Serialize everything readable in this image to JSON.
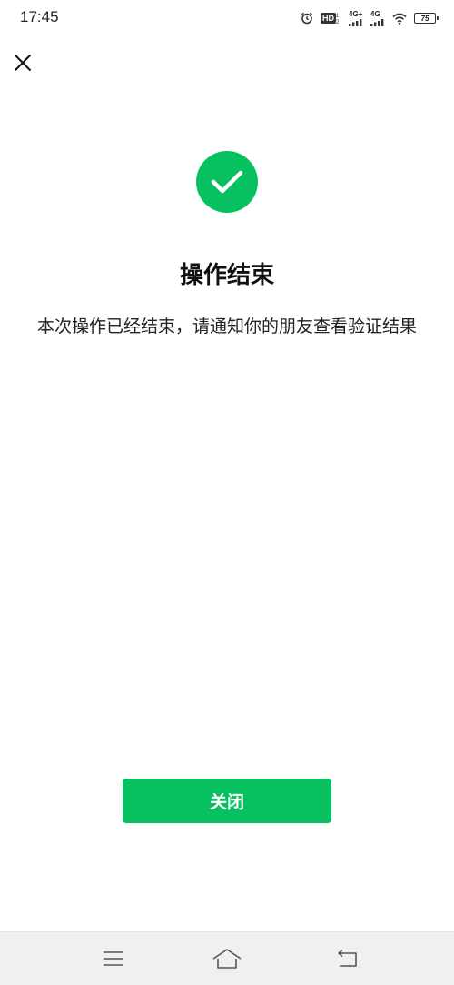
{
  "status_bar": {
    "time": "17:45",
    "hd_label": "HD",
    "sim1_network": "4G+",
    "sim2_network": "4G",
    "battery_level": "75",
    "icons": [
      "alarm-icon",
      "hd-icon",
      "signal-icon",
      "wifi-icon",
      "battery-icon"
    ]
  },
  "header": {
    "close_icon": "close-icon"
  },
  "result": {
    "icon": "checkmark-icon",
    "icon_color": "#07c160",
    "title": "操作结束",
    "message": "本次操作已经结束，请通知你的朋友查看验证结果"
  },
  "actions": {
    "close_label": "关闭",
    "accent": "#07c160"
  },
  "nav_bar": {
    "icons": [
      "menu-icon",
      "home-icon",
      "back-icon"
    ]
  }
}
